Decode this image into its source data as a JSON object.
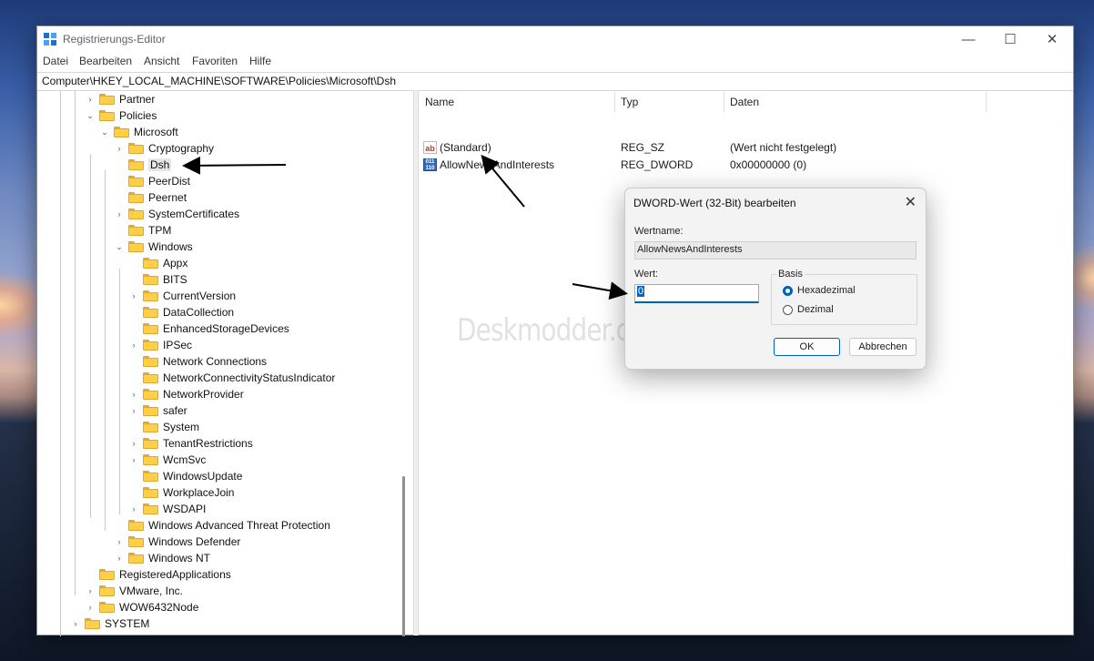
{
  "window": {
    "title": "Registrierungs-Editor",
    "controls": {
      "minimize": "—",
      "maximize": "☐",
      "close": "✕"
    }
  },
  "menu": [
    "Datei",
    "Bearbeiten",
    "Ansicht",
    "Favoriten",
    "Hilfe"
  ],
  "address": "Computer\\HKEY_LOCAL_MACHINE\\SOFTWARE\\Policies\\Microsoft\\Dsh",
  "tree": {
    "partner": "Partner",
    "policies": "Policies",
    "microsoft": "Microsoft",
    "cryptography": "Cryptography",
    "dsh": "Dsh",
    "peerdist": "PeerDist",
    "peernet": "Peernet",
    "systemcertificates": "SystemCertificates",
    "tpm": "TPM",
    "windows": "Windows",
    "appx": "Appx",
    "bits": "BITS",
    "currentversion": "CurrentVersion",
    "datacollection": "DataCollection",
    "enhancedstoragedevices": "EnhancedStorageDevices",
    "ipsec": "IPSec",
    "networkconnections": "Network Connections",
    "ncsi": "NetworkConnectivityStatusIndicator",
    "networkprovider": "NetworkProvider",
    "safer": "safer",
    "system": "System",
    "tenantrestrictions": "TenantRestrictions",
    "wcmsvc": "WcmSvc",
    "windowsupdate": "WindowsUpdate",
    "workplacejoin": "WorkplaceJoin",
    "wsdapi": "WSDAPI",
    "watp": "Windows Advanced Threat Protection",
    "windowsdefender": "Windows Defender",
    "windowsnt": "Windows NT",
    "registeredapplications": "RegisteredApplications",
    "vmware": "VMware, Inc.",
    "wow6432node": "WOW6432Node",
    "systemroot": "SYSTEM"
  },
  "columns": {
    "name": "Name",
    "type": "Typ",
    "data": "Daten"
  },
  "values": [
    {
      "icon": "string-value-icon",
      "glyph": "ab",
      "name": "(Standard)",
      "type": "REG_SZ",
      "data": "(Wert nicht festgelegt)"
    },
    {
      "icon": "dword-value-icon",
      "glyph": "011\n110",
      "name": "AllowNewsAndInterests",
      "type": "REG_DWORD",
      "data": "0x00000000 (0)"
    }
  ],
  "watermark": "Deskmodder.de",
  "dialog": {
    "title": "DWORD-Wert (32-Bit) bearbeiten",
    "close": "✕",
    "valuename_label": "Wertname:",
    "valuename": "AllowNewsAndInterests",
    "value_label": "Wert:",
    "value": "0",
    "base_label": "Basis",
    "hex_label": "Hexadezimal",
    "dec_label": "Dezimal",
    "base_selected": "Hexadezimal",
    "ok": "OK",
    "cancel": "Abbrechen"
  }
}
